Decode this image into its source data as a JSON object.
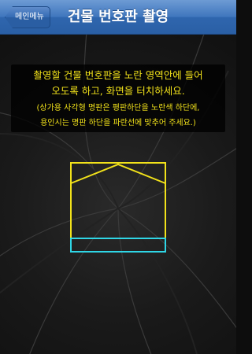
{
  "navbar": {
    "back_label": "메인메뉴",
    "title": "건물 번호판 촬영"
  },
  "instructions": {
    "main_line1": "촬영할 건물 번호판을 노란 영역안에 들어",
    "main_line2": "오도록 하고, 화면을 터치하세요.",
    "note_line1": "(상가용 사각형 명판은 평판하단을 노란색 하단에,",
    "note_line2": "용인시는 명판 하단을 파란선에 맞추어 주세요.)"
  },
  "colors": {
    "navbar_blue": "#3f76bd",
    "instruction_text": "#f2e21a",
    "guide_yellow": "#f2e21a",
    "guide_cyan": "#2fd6e6"
  }
}
